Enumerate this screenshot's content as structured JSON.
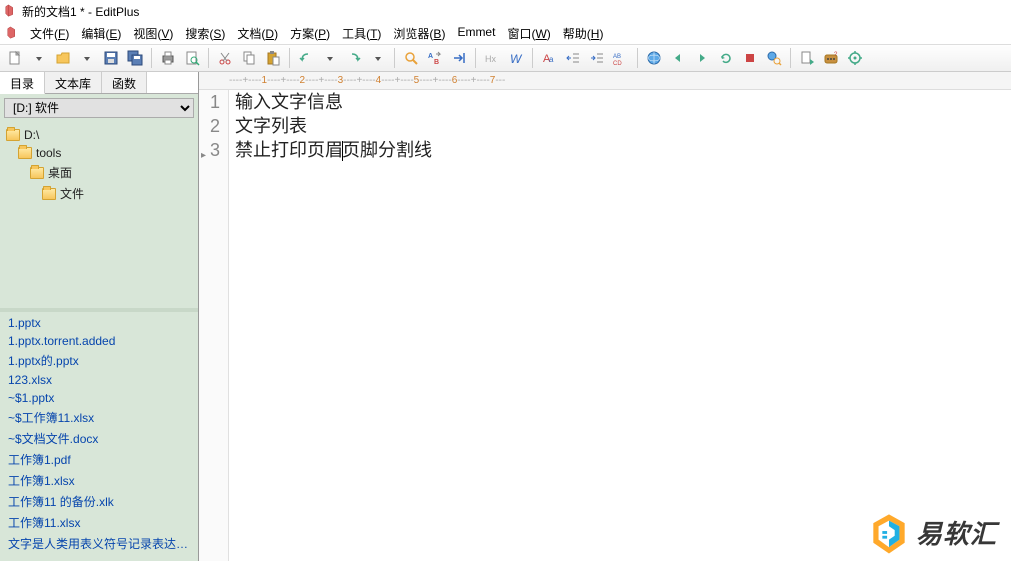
{
  "title": "新的文档1 * - EditPlus",
  "menus": [
    "文件(F)",
    "编辑(E)",
    "视图(V)",
    "搜索(S)",
    "文档(D)",
    "方案(P)",
    "工具(T)",
    "浏览器(B)",
    "Emmet",
    "窗口(W)",
    "帮助(H)"
  ],
  "side_tabs": [
    "目录",
    "文本库",
    "函数"
  ],
  "drive": "[D:] 软件",
  "folders": [
    {
      "label": "D:\\",
      "indent": 0
    },
    {
      "label": "tools",
      "indent": 1
    },
    {
      "label": "桌面",
      "indent": 2
    },
    {
      "label": "文件",
      "indent": 3
    }
  ],
  "files": [
    "1.pptx",
    "1.pptx.torrent.added",
    "1.pptx的.pptx",
    "123.xlsx",
    "~$1.pptx",
    "~$工作簿11.xlsx",
    "~$文档文件.docx",
    "工作簿1.pdf",
    "工作簿1.xlsx",
    "工作簿11 的备份.xlk",
    "工作簿11.xlsx",
    "文字是人类用表义符号记录表达信!"
  ],
  "ruler": {
    "segments": [
      {
        "t": "----+----",
        "k": "dash"
      },
      {
        "t": "1",
        "k": "num"
      },
      {
        "t": "----+----",
        "k": "dash"
      },
      {
        "t": "2",
        "k": "num"
      },
      {
        "t": "----+----",
        "k": "dash"
      },
      {
        "t": "3",
        "k": "num"
      },
      {
        "t": "----+----",
        "k": "dash"
      },
      {
        "t": "4",
        "k": "num"
      },
      {
        "t": "----+----",
        "k": "dash"
      },
      {
        "t": "5",
        "k": "num"
      },
      {
        "t": "----+----",
        "k": "dash"
      },
      {
        "t": "6",
        "k": "num"
      },
      {
        "t": "----+----",
        "k": "dash"
      },
      {
        "t": "7",
        "k": "num"
      },
      {
        "t": "---",
        "k": "dash"
      }
    ]
  },
  "lines": [
    {
      "n": "1",
      "text": "输入文字信息"
    },
    {
      "n": "2",
      "text": "文字列表"
    },
    {
      "n": "3",
      "text_a": "禁止打印页眉",
      "text_b": "页脚分割线",
      "current": true
    }
  ],
  "watermark": "易软汇"
}
